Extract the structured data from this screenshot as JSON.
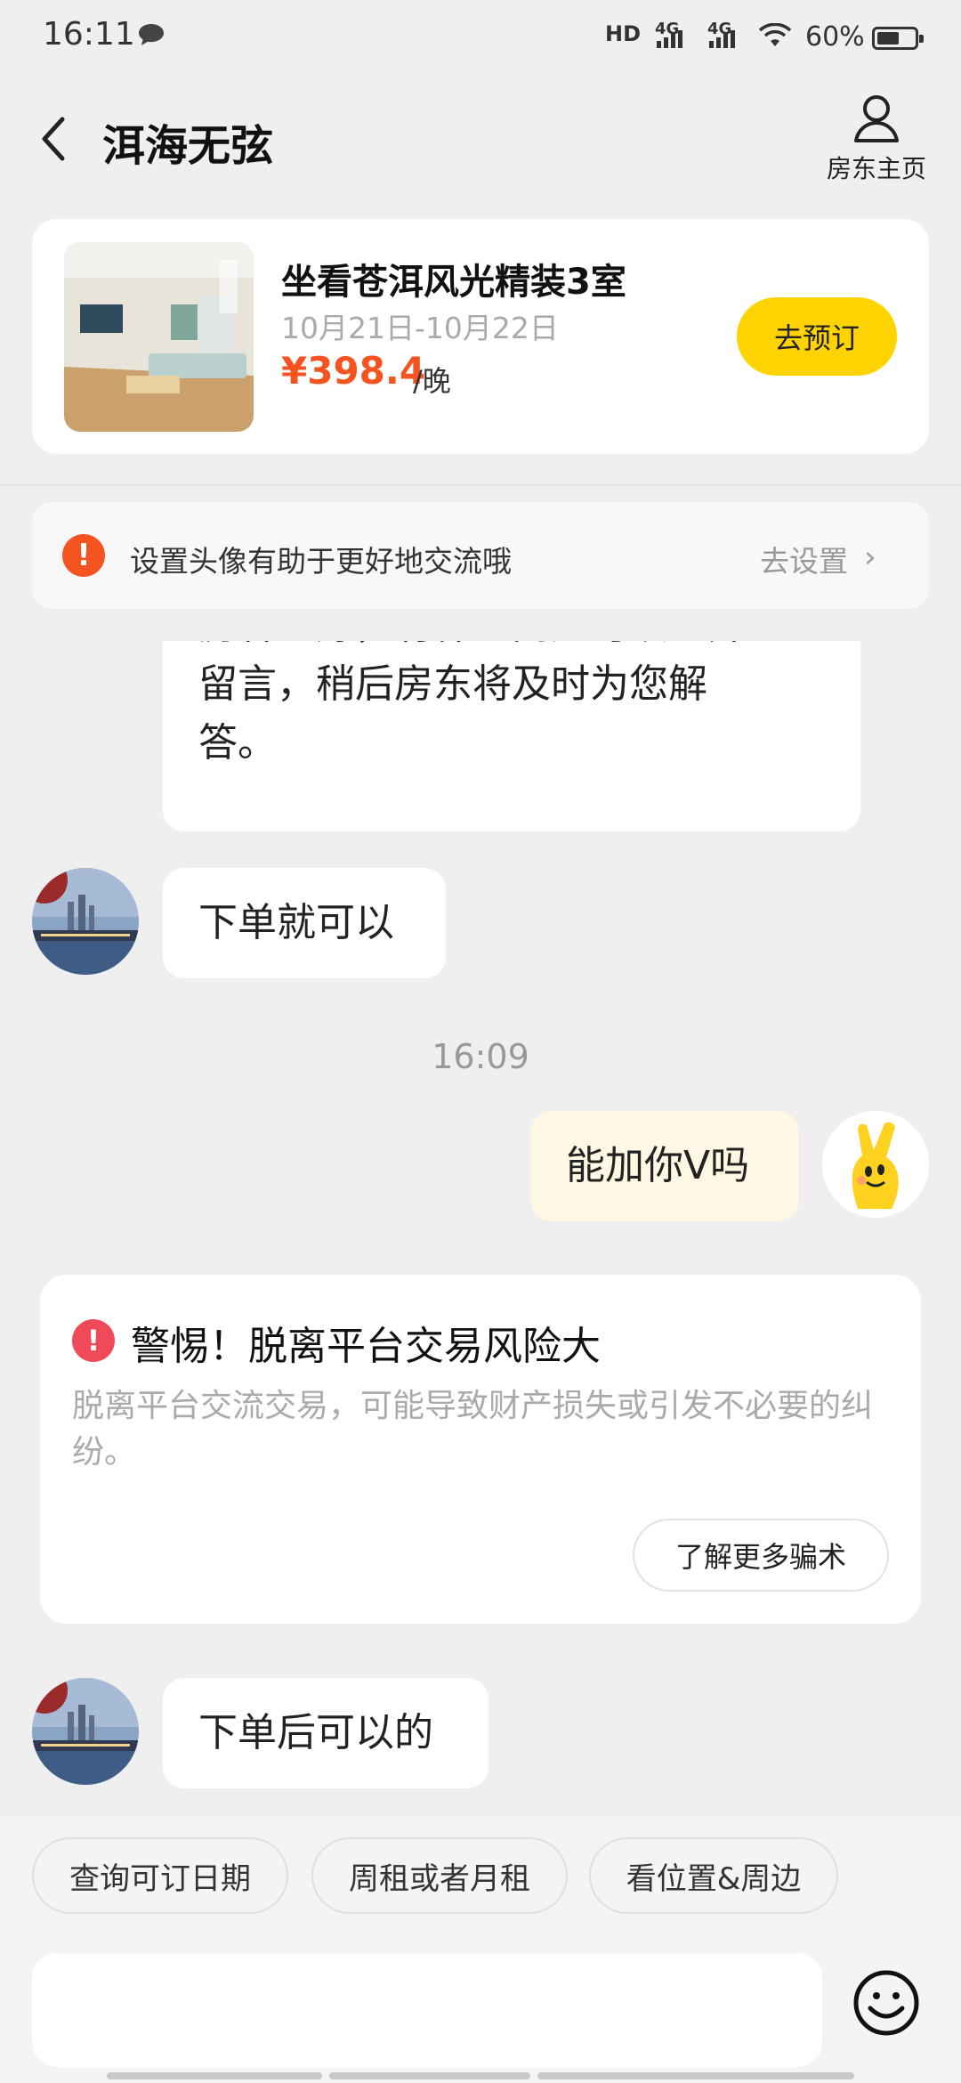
{
  "status_bar": {
    "time": "16:11",
    "hd_label": "HD",
    "net_1": "4G",
    "net_2": "4G",
    "battery_text": "60%",
    "battery_level": 0.6
  },
  "header": {
    "title": "洱海无弦",
    "landlord_home_label": "房东主页"
  },
  "listing": {
    "title": "坐看苍洱风光精装3室",
    "dates": "10月21日-10月22日",
    "price": "¥398.4",
    "unit": "/晚",
    "book_label": "去预订"
  },
  "notice": {
    "icon_text": "!",
    "text": "设置头像有助于更好地交流哦",
    "action": "去设置"
  },
  "chat": {
    "welcome_lines": [
      "房客您好，有什么问题可以一并",
      "留言，稍后房东将及时为您解",
      "答。"
    ],
    "landlord_msg_1": "下单就可以",
    "timestamp": "16:09",
    "user_msg_1": "能加你V吗",
    "warning": {
      "icon_text": "!",
      "title": "警惕！脱离平台交易风险大",
      "body": "脱离平台交流交易，可能导致财产损失或引发不必要的纠纷。",
      "button": "了解更多骗术"
    },
    "landlord_msg_2": "下单后可以的"
  },
  "quick_replies": [
    "查询可订日期",
    "周租或者月租",
    "看位置&周边"
  ],
  "input": {
    "value": "",
    "placeholder": ""
  },
  "icons": {
    "back": "back-arrow-icon",
    "landlord": "person-icon",
    "emoji": "smiley-icon"
  },
  "colors": {
    "accent_yellow": "#ffd300",
    "price_orange": "#f5531f",
    "warning_red": "#f04a5a"
  }
}
